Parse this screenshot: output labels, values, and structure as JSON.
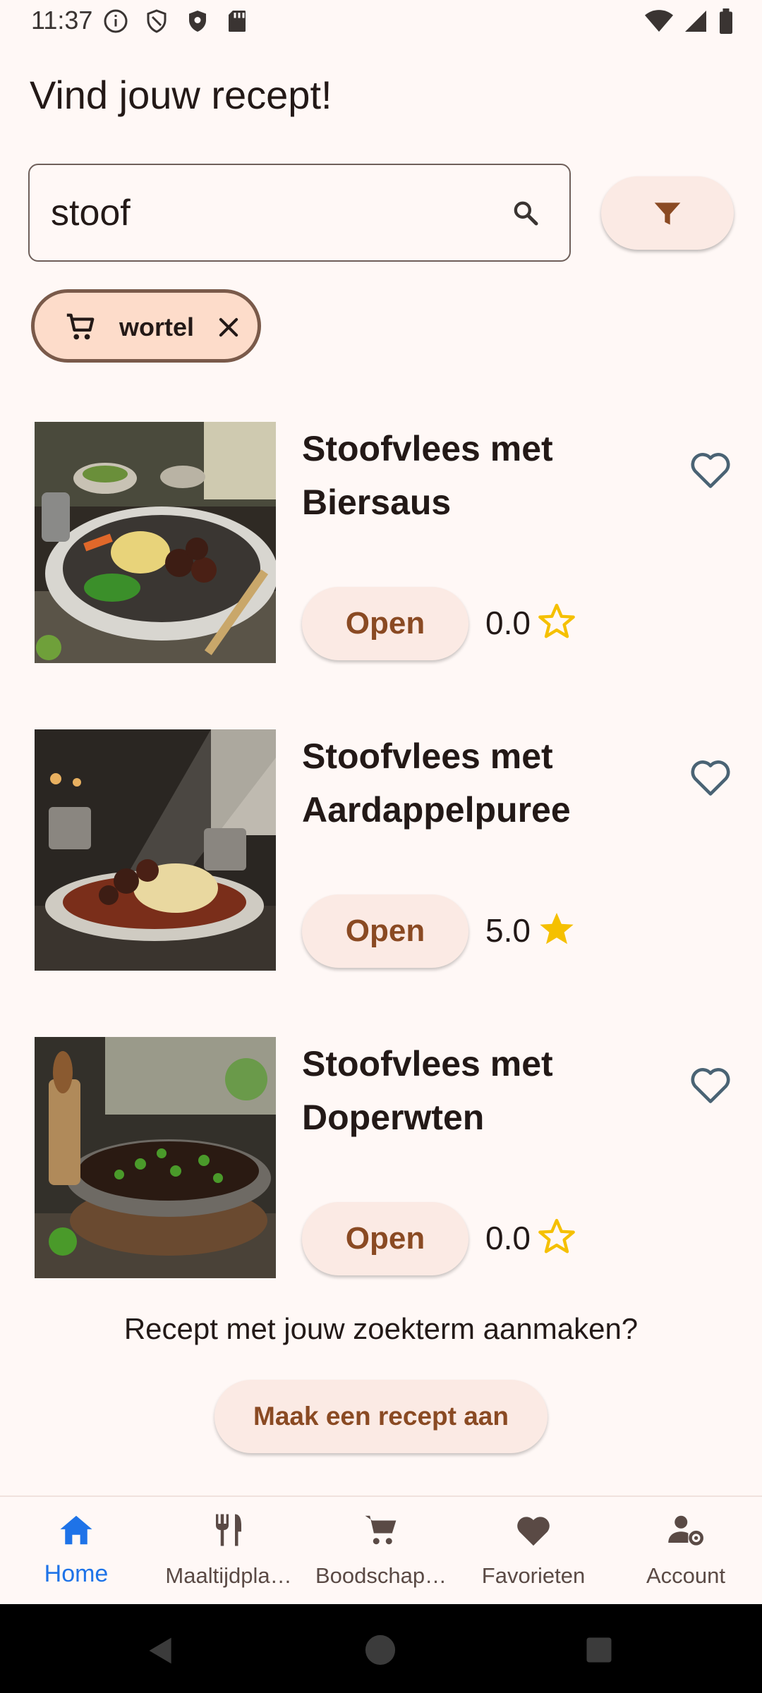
{
  "status_bar": {
    "time": "11:37",
    "left_icons": [
      "info-icon",
      "shield-outline-icon",
      "shield-icon",
      "sd-card-icon"
    ],
    "right_icons": [
      "wifi-icon",
      "signal-icon",
      "battery-icon"
    ]
  },
  "page": {
    "title": "Vind jouw recept!"
  },
  "search": {
    "value": "stoof",
    "icon": "search-icon"
  },
  "filter": {
    "icon": "filter-icon"
  },
  "chips": [
    {
      "label": "wortel",
      "icon": "cart-icon"
    }
  ],
  "recipes": [
    {
      "title": "Stoofvlees met Biersaus",
      "open_label": "Open",
      "rating": "0.0",
      "star_filled": false
    },
    {
      "title": "Stoofvlees met Aardappelpuree",
      "open_label": "Open",
      "rating": "5.0",
      "star_filled": true
    },
    {
      "title": "Stoofvlees met Doperwten",
      "open_label": "Open",
      "rating": "0.0",
      "star_filled": false
    }
  ],
  "create": {
    "prompt": "Recept met jouw zoekterm aanmaken?",
    "button_label": "Maak een recept aan"
  },
  "bottom_nav": [
    {
      "label": "Home",
      "icon": "home-icon",
      "active": true
    },
    {
      "label": "Maaltijdpla…",
      "icon": "utensils-icon",
      "active": false
    },
    {
      "label": "Boodschap…",
      "icon": "cart-icon",
      "active": false
    },
    {
      "label": "Favorieten",
      "icon": "heart-icon",
      "active": false
    },
    {
      "label": "Account",
      "icon": "account-settings-icon",
      "active": false
    }
  ],
  "colors": {
    "background": "#fff8f6",
    "accent_brown": "#8a4a23",
    "chip_bg": "#fddcca",
    "active_nav": "#1e73e8",
    "star": "#f5c000",
    "heart_outline": "#4a6374"
  }
}
